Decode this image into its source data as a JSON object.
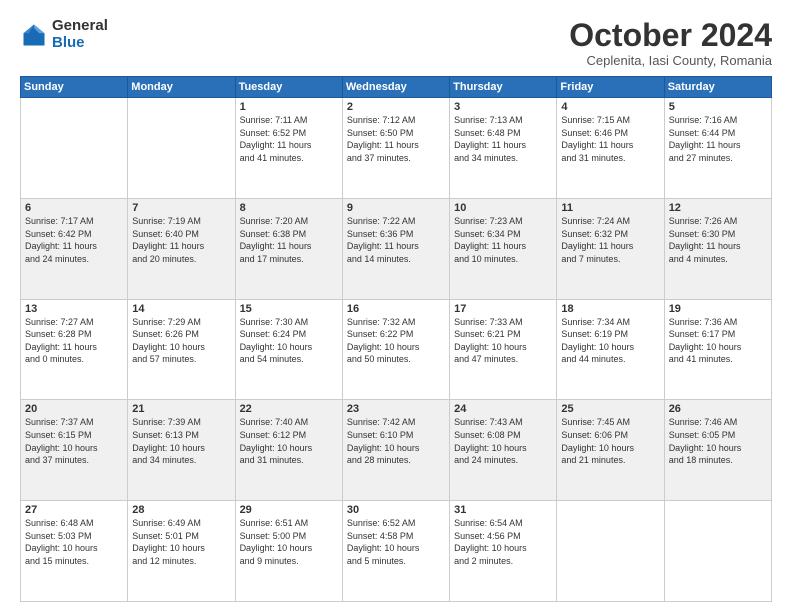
{
  "logo": {
    "general": "General",
    "blue": "Blue"
  },
  "title": "October 2024",
  "subtitle": "Ceplenita, Iasi County, Romania",
  "days": [
    "Sunday",
    "Monday",
    "Tuesday",
    "Wednesday",
    "Thursday",
    "Friday",
    "Saturday"
  ],
  "weeks": [
    [
      {
        "day": "",
        "content": ""
      },
      {
        "day": "",
        "content": ""
      },
      {
        "day": "1",
        "content": "Sunrise: 7:11 AM\nSunset: 6:52 PM\nDaylight: 11 hours\nand 41 minutes."
      },
      {
        "day": "2",
        "content": "Sunrise: 7:12 AM\nSunset: 6:50 PM\nDaylight: 11 hours\nand 37 minutes."
      },
      {
        "day": "3",
        "content": "Sunrise: 7:13 AM\nSunset: 6:48 PM\nDaylight: 11 hours\nand 34 minutes."
      },
      {
        "day": "4",
        "content": "Sunrise: 7:15 AM\nSunset: 6:46 PM\nDaylight: 11 hours\nand 31 minutes."
      },
      {
        "day": "5",
        "content": "Sunrise: 7:16 AM\nSunset: 6:44 PM\nDaylight: 11 hours\nand 27 minutes."
      }
    ],
    [
      {
        "day": "6",
        "content": "Sunrise: 7:17 AM\nSunset: 6:42 PM\nDaylight: 11 hours\nand 24 minutes."
      },
      {
        "day": "7",
        "content": "Sunrise: 7:19 AM\nSunset: 6:40 PM\nDaylight: 11 hours\nand 20 minutes."
      },
      {
        "day": "8",
        "content": "Sunrise: 7:20 AM\nSunset: 6:38 PM\nDaylight: 11 hours\nand 17 minutes."
      },
      {
        "day": "9",
        "content": "Sunrise: 7:22 AM\nSunset: 6:36 PM\nDaylight: 11 hours\nand 14 minutes."
      },
      {
        "day": "10",
        "content": "Sunrise: 7:23 AM\nSunset: 6:34 PM\nDaylight: 11 hours\nand 10 minutes."
      },
      {
        "day": "11",
        "content": "Sunrise: 7:24 AM\nSunset: 6:32 PM\nDaylight: 11 hours\nand 7 minutes."
      },
      {
        "day": "12",
        "content": "Sunrise: 7:26 AM\nSunset: 6:30 PM\nDaylight: 11 hours\nand 4 minutes."
      }
    ],
    [
      {
        "day": "13",
        "content": "Sunrise: 7:27 AM\nSunset: 6:28 PM\nDaylight: 11 hours\nand 0 minutes."
      },
      {
        "day": "14",
        "content": "Sunrise: 7:29 AM\nSunset: 6:26 PM\nDaylight: 10 hours\nand 57 minutes."
      },
      {
        "day": "15",
        "content": "Sunrise: 7:30 AM\nSunset: 6:24 PM\nDaylight: 10 hours\nand 54 minutes."
      },
      {
        "day": "16",
        "content": "Sunrise: 7:32 AM\nSunset: 6:22 PM\nDaylight: 10 hours\nand 50 minutes."
      },
      {
        "day": "17",
        "content": "Sunrise: 7:33 AM\nSunset: 6:21 PM\nDaylight: 10 hours\nand 47 minutes."
      },
      {
        "day": "18",
        "content": "Sunrise: 7:34 AM\nSunset: 6:19 PM\nDaylight: 10 hours\nand 44 minutes."
      },
      {
        "day": "19",
        "content": "Sunrise: 7:36 AM\nSunset: 6:17 PM\nDaylight: 10 hours\nand 41 minutes."
      }
    ],
    [
      {
        "day": "20",
        "content": "Sunrise: 7:37 AM\nSunset: 6:15 PM\nDaylight: 10 hours\nand 37 minutes."
      },
      {
        "day": "21",
        "content": "Sunrise: 7:39 AM\nSunset: 6:13 PM\nDaylight: 10 hours\nand 34 minutes."
      },
      {
        "day": "22",
        "content": "Sunrise: 7:40 AM\nSunset: 6:12 PM\nDaylight: 10 hours\nand 31 minutes."
      },
      {
        "day": "23",
        "content": "Sunrise: 7:42 AM\nSunset: 6:10 PM\nDaylight: 10 hours\nand 28 minutes."
      },
      {
        "day": "24",
        "content": "Sunrise: 7:43 AM\nSunset: 6:08 PM\nDaylight: 10 hours\nand 24 minutes."
      },
      {
        "day": "25",
        "content": "Sunrise: 7:45 AM\nSunset: 6:06 PM\nDaylight: 10 hours\nand 21 minutes."
      },
      {
        "day": "26",
        "content": "Sunrise: 7:46 AM\nSunset: 6:05 PM\nDaylight: 10 hours\nand 18 minutes."
      }
    ],
    [
      {
        "day": "27",
        "content": "Sunrise: 6:48 AM\nSunset: 5:03 PM\nDaylight: 10 hours\nand 15 minutes."
      },
      {
        "day": "28",
        "content": "Sunrise: 6:49 AM\nSunset: 5:01 PM\nDaylight: 10 hours\nand 12 minutes."
      },
      {
        "day": "29",
        "content": "Sunrise: 6:51 AM\nSunset: 5:00 PM\nDaylight: 10 hours\nand 9 minutes."
      },
      {
        "day": "30",
        "content": "Sunrise: 6:52 AM\nSunset: 4:58 PM\nDaylight: 10 hours\nand 5 minutes."
      },
      {
        "day": "31",
        "content": "Sunrise: 6:54 AM\nSunset: 4:56 PM\nDaylight: 10 hours\nand 2 minutes."
      },
      {
        "day": "",
        "content": ""
      },
      {
        "day": "",
        "content": ""
      }
    ]
  ]
}
